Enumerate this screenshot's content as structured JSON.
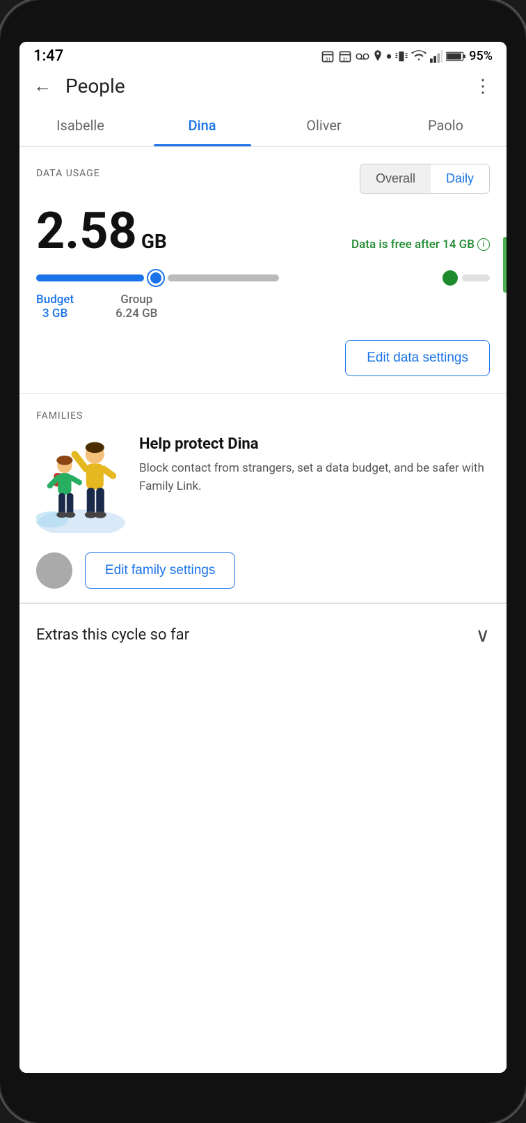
{
  "statusBar": {
    "time": "1:47",
    "battery": "95%"
  },
  "toolbar": {
    "title": "People",
    "back_label": "←",
    "more_label": "⋮"
  },
  "tabs": [
    {
      "id": "isabelle",
      "label": "Isabelle",
      "active": false
    },
    {
      "id": "dina",
      "label": "Dina",
      "active": true
    },
    {
      "id": "oliver",
      "label": "Oliver",
      "active": false
    },
    {
      "id": "paolo",
      "label": "Paolo",
      "active": false
    }
  ],
  "dataUsage": {
    "label": "DATA USAGE",
    "toggleOverall": "Overall",
    "toggleDaily": "Daily",
    "amount": "2.58",
    "unit": "GB",
    "freeInfo": "Data is free after 14 GB",
    "budgetLabel": "Budget",
    "budgetValue": "3 GB",
    "groupLabel": "Group",
    "groupValue": "6.24 GB",
    "editButton": "Edit data settings"
  },
  "families": {
    "label": "FAMILIES",
    "title": "Help protect Dina",
    "description": "Block contact from strangers, set a data budget, and be safer with Family Link.",
    "editButton": "Edit family settings"
  },
  "extras": {
    "label": "Extras this cycle so far"
  },
  "colors": {
    "blue": "#1a73e8",
    "green": "#1e8a2e",
    "gray": "#666"
  }
}
